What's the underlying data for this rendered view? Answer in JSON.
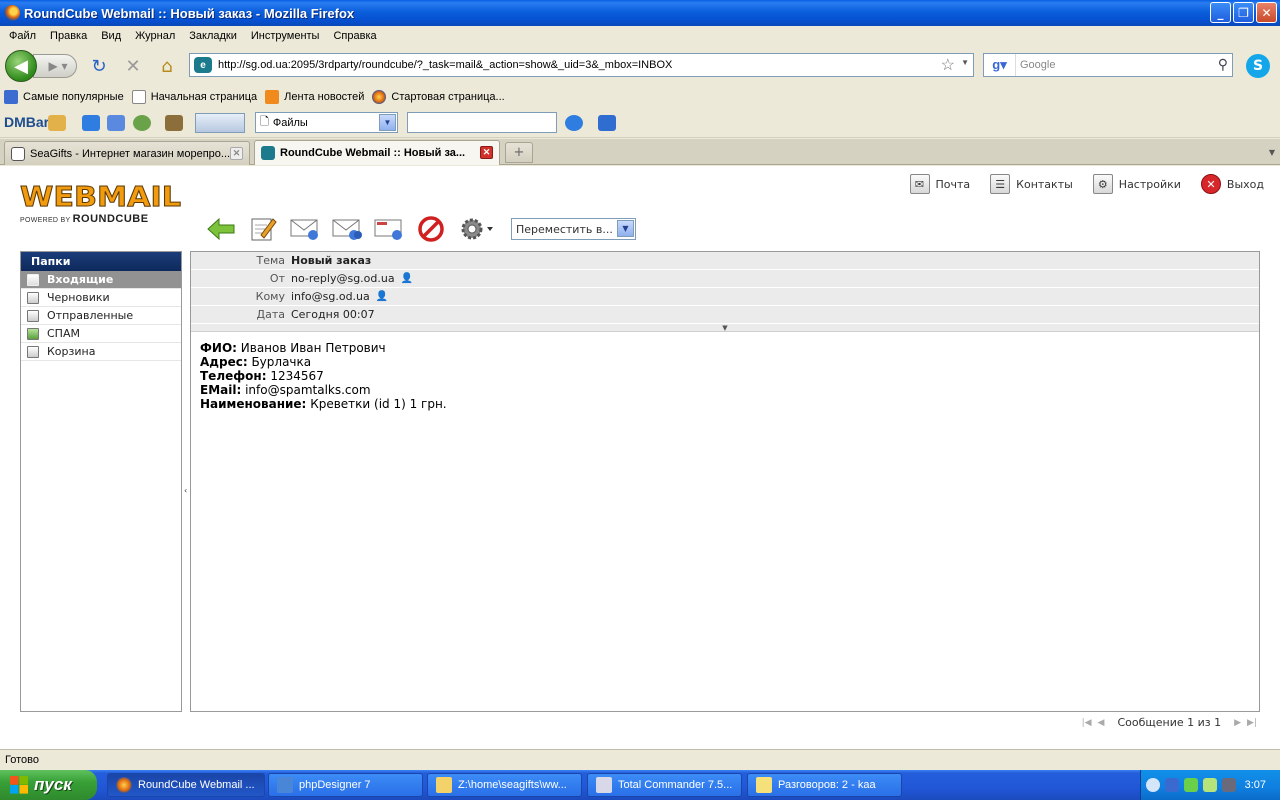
{
  "browser": {
    "title": "RoundCube Webmail :: Новый заказ - Mozilla Firefox",
    "menu": [
      "Файл",
      "Правка",
      "Вид",
      "Журнал",
      "Закладки",
      "Инструменты",
      "Справка"
    ],
    "url": "http://sg.od.ua:2095/3rdparty/roundcube/?_task=mail&_action=show&_uid=3&_mbox=INBOX",
    "search_placeholder": "Google",
    "bookmarks": [
      "Самые популярные",
      "Начальная страница",
      "Лента новостей",
      "Стартовая страница..."
    ],
    "dmbar": {
      "logo": "DMBar",
      "select_value": "Файлы"
    },
    "tabs": [
      {
        "label": "SeaGifts - Интернет магазин морепро...",
        "active": false
      },
      {
        "label": "RoundCube Webmail :: Новый за...",
        "active": true
      }
    ],
    "status": "Готово"
  },
  "webmail": {
    "logo_main": "WEBMAIL",
    "logo_powered": "POWERED BY",
    "logo_brand": "ROUNDCUBE",
    "topnav": [
      {
        "label": "Почта",
        "icon": "mail-icon"
      },
      {
        "label": "Контакты",
        "icon": "contacts-icon"
      },
      {
        "label": "Настройки",
        "icon": "settings-icon"
      },
      {
        "label": "Выход",
        "icon": "logout-icon"
      }
    ],
    "move_select": "Переместить в...",
    "folders_title": "Папки",
    "folders": [
      {
        "label": "Входящие",
        "selected": true
      },
      {
        "label": "Черновики",
        "selected": false
      },
      {
        "label": "Отправленные",
        "selected": false
      },
      {
        "label": "СПАМ",
        "selected": false
      },
      {
        "label": "Корзина",
        "selected": false
      }
    ],
    "headers": {
      "subject_label": "Тема",
      "subject": "Новый заказ",
      "from_label": "От",
      "from": "no-reply@sg.od.ua",
      "to_label": "Кому",
      "to": "info@sg.od.ua",
      "date_label": "Дата",
      "date": "Сегодня 00:07"
    },
    "body": [
      {
        "label": "ФИО:",
        "value": "Иванов Иван Петрович"
      },
      {
        "label": "Адрес:",
        "value": "Бурлачка"
      },
      {
        "label": "Телефон:",
        "value": "1234567"
      },
      {
        "label": "EMail:",
        "value": "info@spamtalks.com"
      },
      {
        "label": "Наименование:",
        "value": "Креветки (id 1) 1 грн."
      }
    ],
    "pager": "Сообщение 1 из 1"
  },
  "taskbar": {
    "start": "пуск",
    "tasks": [
      {
        "label": "RoundCube Webmail ...",
        "active": true
      },
      {
        "label": "phpDesigner 7",
        "active": false
      },
      {
        "label": "Z:\\home\\seagifts\\ww...",
        "active": false
      },
      {
        "label": "Total Commander 7.5...",
        "active": false
      },
      {
        "label": "Разговоров: 2 - kaa",
        "active": false
      }
    ],
    "clock": "3:07"
  }
}
